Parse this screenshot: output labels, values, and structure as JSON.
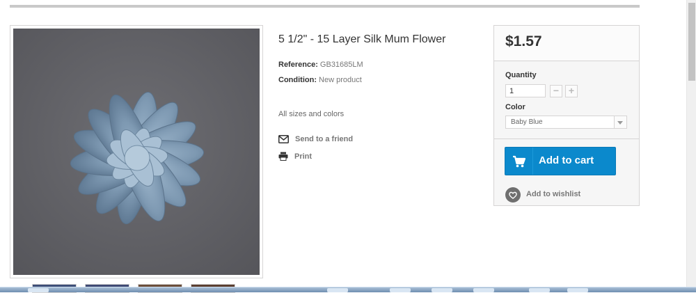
{
  "product": {
    "title": "5 1/2\" - 15 Layer Silk Mum Flower",
    "reference_label": "Reference:",
    "reference_value": "GB31685LM",
    "condition_label": "Condition:",
    "condition_value": "New product",
    "short_description": "All sizes and colors",
    "image_color": "#7c95ad"
  },
  "actions": {
    "send_to_friend": "Send to a friend",
    "print": "Print"
  },
  "buy_box": {
    "price": "$1.57",
    "quantity_label": "Quantity",
    "quantity_value": "1",
    "minus_symbol": "−",
    "plus_symbol": "+",
    "color_label": "Color",
    "color_selected": "Baby Blue",
    "add_to_cart": "Add to cart",
    "add_to_wishlist": "Add to wishlist"
  },
  "colors": {
    "accent": "#0b89cc",
    "price_box_bg": "#f6f6f6"
  },
  "icons": {
    "send": "envelope-icon",
    "print": "printer-icon",
    "cart": "shopping-cart-icon",
    "wishlist": "heart-icon"
  }
}
